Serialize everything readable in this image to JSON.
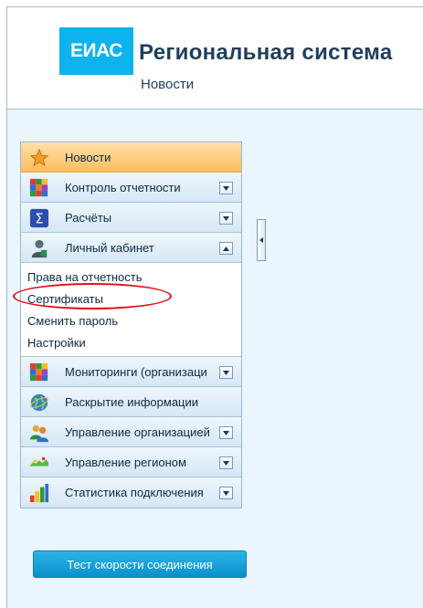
{
  "header": {
    "logo_text": "ЕИАС",
    "title": "Региональная система",
    "subtitle": "Новости"
  },
  "nav": {
    "items": [
      {
        "label": "Новости",
        "icon": "star-icon",
        "active": true,
        "toggle": ""
      },
      {
        "label": "Контроль отчетности",
        "icon": "colored-blocks-icon",
        "toggle": "down"
      },
      {
        "label": "Расчёты",
        "icon": "sigma-icon",
        "toggle": "down"
      },
      {
        "label": "Личный кабинет",
        "icon": "user-icon",
        "toggle": "up"
      },
      {
        "label": "Мониторинги (организаци",
        "icon": "colored-blocks-icon",
        "toggle": "down"
      },
      {
        "label": "Раскрытие информации",
        "icon": "globe-icon",
        "toggle": ""
      },
      {
        "label": "Управление организацией",
        "icon": "users-icon",
        "toggle": "down"
      },
      {
        "label": "Управление регионом",
        "icon": "region-map-icon",
        "toggle": "down"
      },
      {
        "label": "Статистика подключения",
        "icon": "bar-chart-icon",
        "toggle": "down"
      }
    ],
    "cabinet_subitems": [
      {
        "label": "Права на отчетность"
      },
      {
        "label": "Сертификаты"
      },
      {
        "label": "Сменить пароль"
      },
      {
        "label": "Настройки"
      }
    ]
  },
  "speed_test_button": "Тест скорости соединения",
  "colors": {
    "logo": "#0db3ec",
    "active_item": "#fbbd5d",
    "highlight": "#e0101a",
    "button": "#0c8fcb",
    "background": "#eaf5fd"
  }
}
